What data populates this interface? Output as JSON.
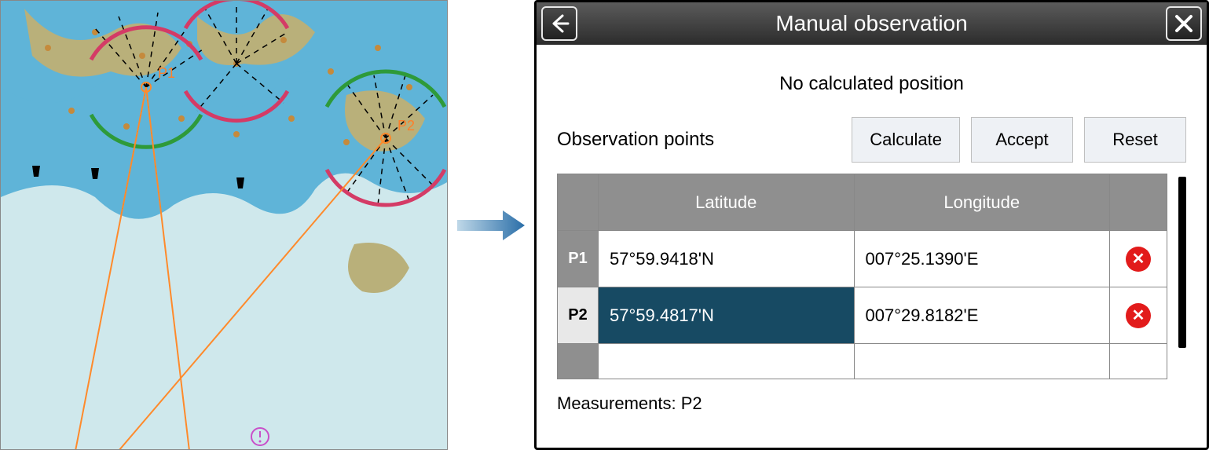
{
  "header": {
    "title": "Manual observation"
  },
  "status": "No calculated position",
  "toolbar": {
    "section_label": "Observation points",
    "calculate": "Calculate",
    "accept": "Accept",
    "reset": "Reset"
  },
  "columns": {
    "latitude": "Latitude",
    "longitude": "Longitude"
  },
  "points": [
    {
      "id": "P1",
      "lat": "57°59.9418'N",
      "lon": "007°25.1390'E",
      "selected": false
    },
    {
      "id": "P2",
      "lat": "57°59.4817'N",
      "lon": "007°29.8182'E",
      "selected": true
    }
  ],
  "measurements_label": "Measurements: P2",
  "chart": {
    "point_labels": [
      "P1",
      "P2"
    ]
  }
}
